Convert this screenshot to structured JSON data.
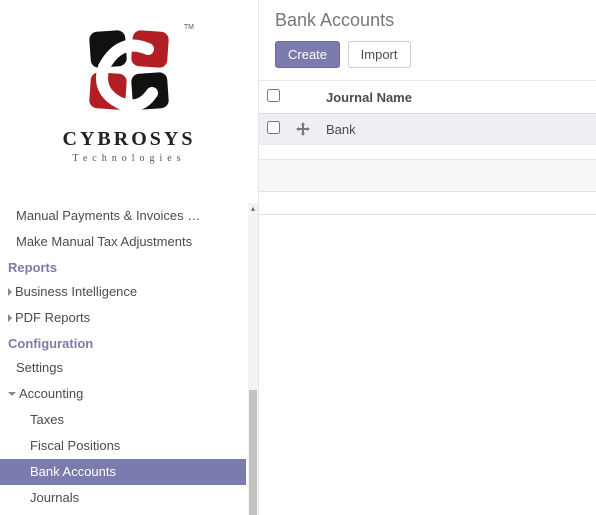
{
  "sidebar": {
    "items_top": [
      {
        "label": "Manual Payments & Invoices …"
      },
      {
        "label": "Make Manual Tax Adjustments"
      }
    ],
    "section_reports": "Reports",
    "reports_children": [
      {
        "label": "Business Intelligence"
      },
      {
        "label": "PDF Reports"
      }
    ],
    "section_config": "Configuration",
    "config_settings": "Settings",
    "config_accounting": "Accounting",
    "accounting_children": [
      {
        "label": "Taxes"
      },
      {
        "label": "Fiscal Positions"
      },
      {
        "label": "Bank Accounts"
      },
      {
        "label": "Journals"
      }
    ]
  },
  "header": {
    "title": "Bank Accounts",
    "create_label": "Create",
    "import_label": "Import"
  },
  "table": {
    "col_journal": "Journal Name",
    "rows": [
      {
        "name": "Bank"
      }
    ]
  }
}
